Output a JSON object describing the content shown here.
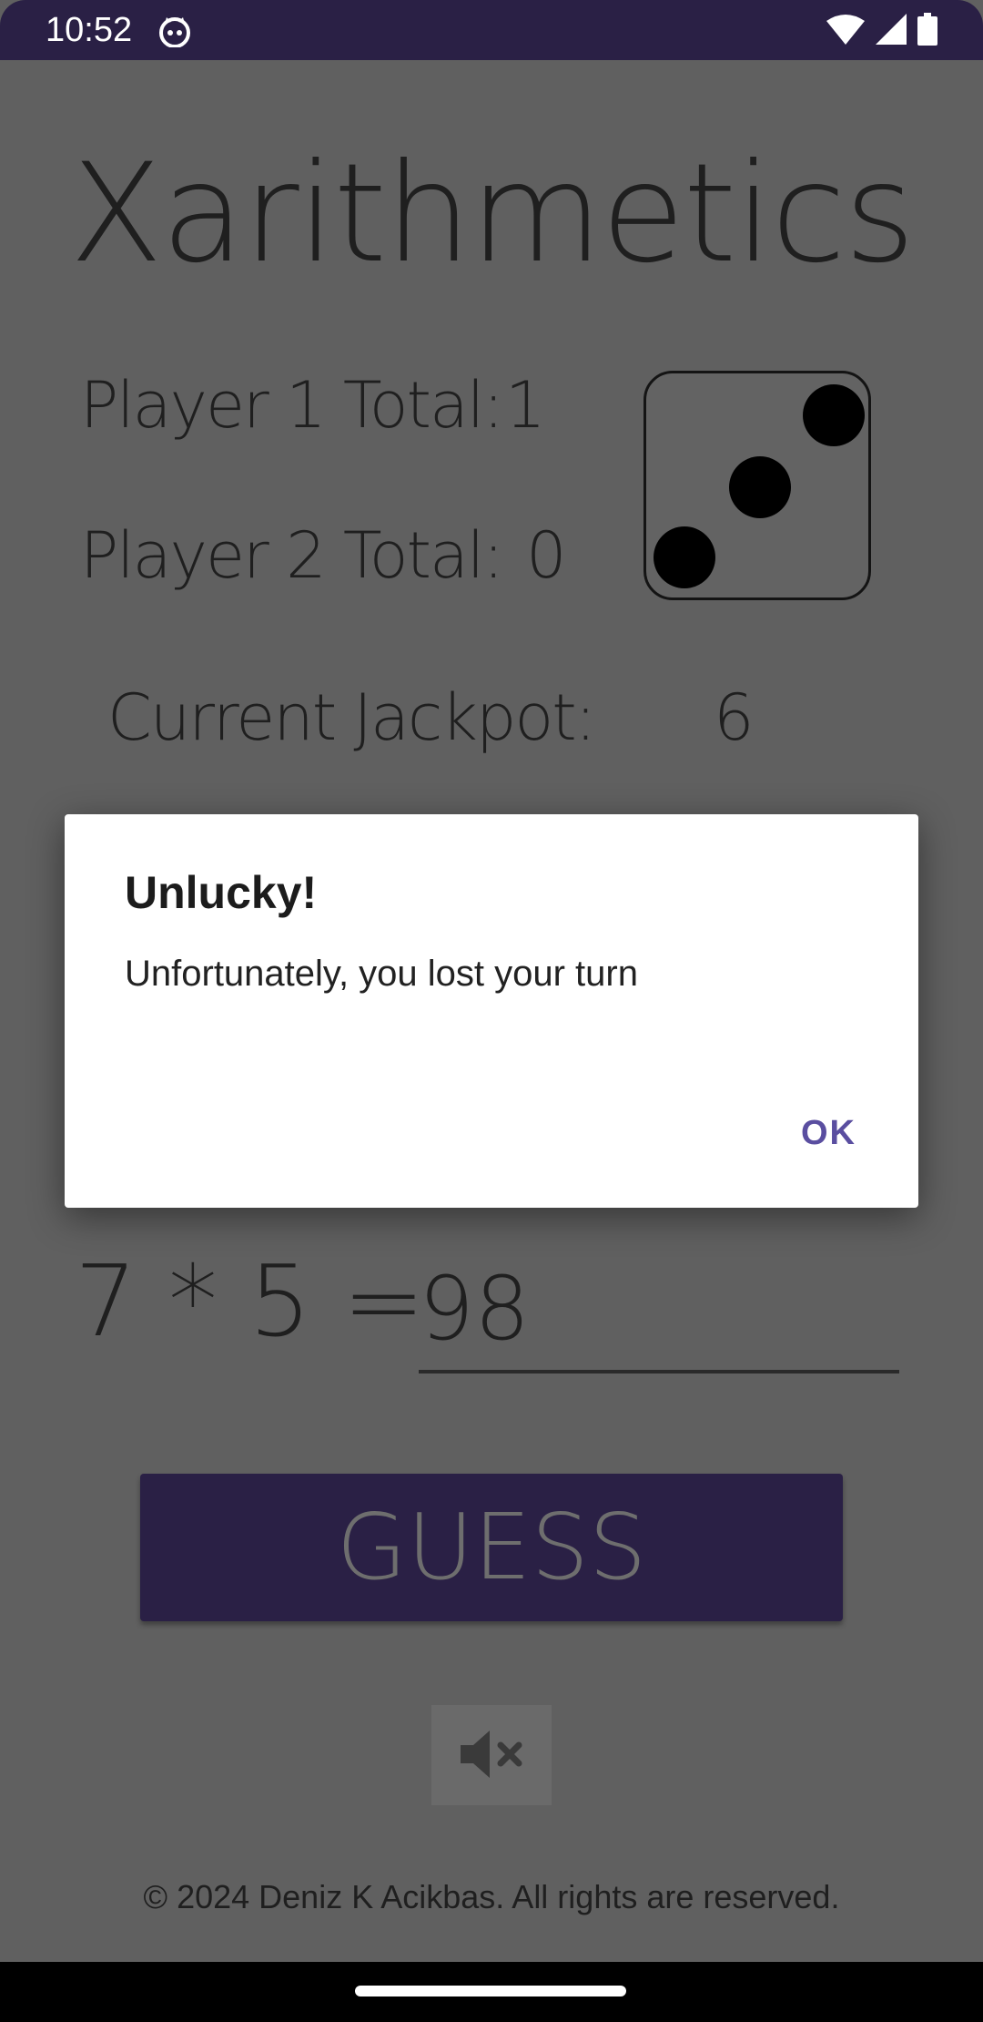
{
  "status_bar": {
    "time": "10:52",
    "icons": [
      "cat-face-icon",
      "wifi-icon",
      "cell-signal-icon",
      "battery-icon"
    ]
  },
  "app": {
    "title": "Xarithmetics",
    "player1_label": "Player 1 Total:",
    "player1_value": "1",
    "player2_label": "Player 2 Total:",
    "player2_value": "0",
    "jackpot_label": "Current Jackpot:",
    "jackpot_value": "6",
    "die_face": 3,
    "equation": "7 * 5 =",
    "answer_value": "98",
    "guess_label": "GUESS",
    "mute_icon": "volume-muted-icon",
    "footer": "© 2024 Deniz K Acikbas. All rights are reserved."
  },
  "dialog": {
    "title": "Unlucky!",
    "message": "Unfortunately, you lost your turn",
    "ok_label": "OK"
  },
  "colors": {
    "background_dimmed": "#606060",
    "status_bar": "#2a2045",
    "guess_button": "#2a2045",
    "dialog_accent": "#5a4ea0"
  }
}
